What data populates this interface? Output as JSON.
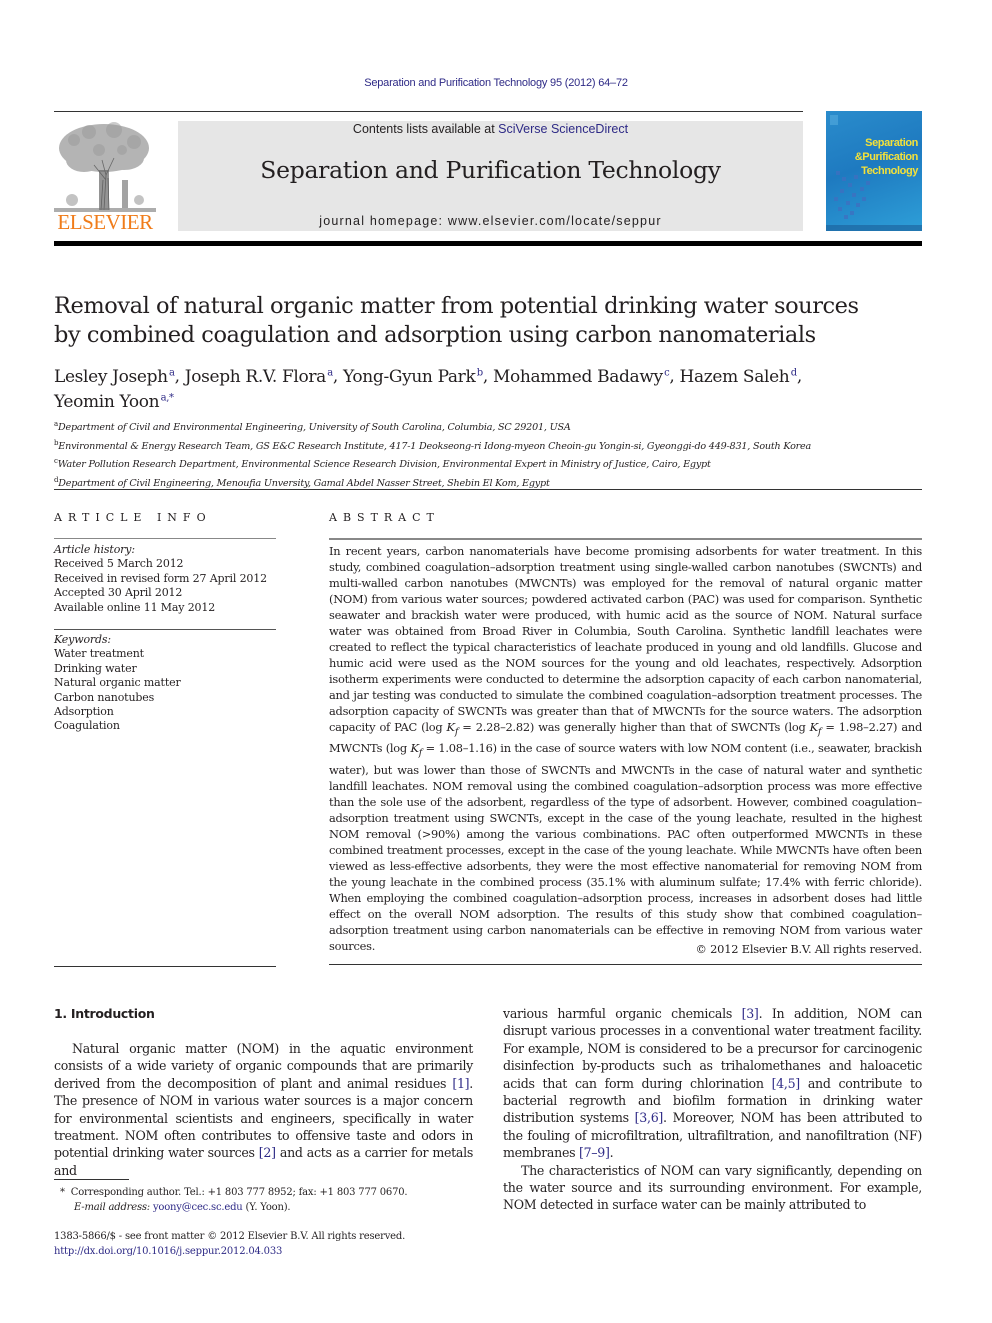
{
  "header": {
    "journal_reference": "Separation and Purification Technology 95 (2012) 64–72",
    "publisher_name": "ELSEVIER",
    "contents_prefix": "Contents lists available at ",
    "contents_link": "SciVerse ScienceDirect",
    "journal_title": "Separation and Purification Technology",
    "homepage_line": "journal homepage: www.elsevier.com/locate/seppur",
    "cover_title_lines": [
      "Separation",
      "&Purification",
      "Technology"
    ],
    "colors": {
      "link": "#2e2a86",
      "publisher_orange": "#f07c1a",
      "masthead_gray": "#e6e6e6",
      "cover_blue": "#1e7ac0",
      "cover_text_yellow": "#f3e13a"
    }
  },
  "article": {
    "title_line1": "Removal of natural organic matter from potential drinking water sources",
    "title_line2": "by combined coagulation and adsorption using carbon nanomaterials",
    "authors": [
      {
        "name": "Lesley Joseph",
        "aff": "a",
        "sep": ", "
      },
      {
        "name": "Joseph R.V. Flora",
        "aff": "a",
        "sep": ", "
      },
      {
        "name": "Yong-Gyun Park",
        "aff": "b",
        "sep": ", "
      },
      {
        "name": "Mohammed Badawy",
        "aff": "c",
        "sep": ", "
      },
      {
        "name": "Hazem Saleh",
        "aff": "d",
        "sep": ","
      },
      {
        "name": "Yeomin Yoon",
        "aff": "a,*",
        "sep": ""
      }
    ],
    "affiliations": [
      {
        "key": "a",
        "text": "Department of Civil and Environmental Engineering, University of South Carolina, Columbia, SC 29201, USA"
      },
      {
        "key": "b",
        "text": "Environmental & Energy Research Team, GS E&C Research Institute, 417-1 Deokseong-ri Idong-myeon Cheoin-gu Yongin-si, Gyeonggi-do 449-831, South Korea"
      },
      {
        "key": "c",
        "text": "Water Pollution Research Department, Environmental Science Research Division, Environmental Expert in Ministry of Justice, Cairo, Egypt"
      },
      {
        "key": "d",
        "text": "Department of Civil Engineering, Menoufia Unversity, Gamal Abdel Nasser Street, Shebin El Kom, Egypt"
      }
    ]
  },
  "article_info": {
    "heading": "ARTICLE INFO",
    "history_label": "Article history:",
    "history": [
      "Received 5 March 2012",
      "Received in revised form 27 April 2012",
      "Accepted 30 April 2012",
      "Available online 11 May 2012"
    ],
    "keywords_label": "Keywords:",
    "keywords": [
      "Water treatment",
      "Drinking water",
      "Natural organic matter",
      "Carbon nanotubes",
      "Adsorption",
      "Coagulation"
    ]
  },
  "abstract": {
    "heading": "ABSTRACT",
    "text_part1": "In recent years, carbon nanomaterials have become promising adsorbents for water treatment. In this study, combined coagulation–adsorption treatment using single-walled carbon nanotubes (SWCNTs) and multi-walled carbon nanotubes (MWCNTs) was employed for the removal of natural organic matter (NOM) from various water sources; powdered activated carbon (PAC) was used for comparison. Synthetic seawater and brackish water were produced, with humic acid as the source of NOM. Natural surface water was obtained from Broad River in Columbia, South Carolina. Synthetic landfill leachates were created to reflect the typical characteristics of leachate produced in young and old landfills. Glucose and humic acid were used as the NOM sources for the young and old leachates, respectively. Adsorption isotherm experiments were conducted to determine the adsorption capacity of each carbon nanomaterial, and jar testing was conducted to simulate the combined coagulation–adsorption treatment processes. The adsorption capacity of SWCNTs was greater than that of MWCNTs for the source waters. The adsorption capacity of PAC (log ",
    "kf_symbol": "K",
    "kf_sub": "f",
    "pac_range": " = 2.28–2.82) was generally higher than that of SWCNTs (log ",
    "swcnt_range": " = 1.98–2.27) and MWCNTs (log ",
    "text_part2": " = 1.08–1.16) in the case of source waters with low NOM content (i.e., seawater, brackish water), but was lower than those of SWCNTs and MWCNTs in the case of natural water and synthetic landfill leachates. NOM removal using the combined coagulation–adsorption process was more effective than the sole use of the adsorbent, regardless of the type of adsorbent. However, combined coagulation–adsorption treatment using SWCNTs, except in the case of the young leachate, resulted in the highest NOM removal (>90%) among the various combinations. PAC often outperformed MWCNTs in these combined treatment processes, except in the case of the young leachate. While MWCNTs have often been viewed as less-effective adsorbents, they were the most effective nanomaterial for removing NOM from the young leachate in the combined process (35.1% with aluminum sulfate; 17.4% with ferric chloride). When employing the combined coagulation–adsorption process, increases in adsorbent doses had little effect on the overall NOM adsorption. The results of this study show that combined coagulation–adsorption treatment using carbon nanomaterials can be effective in removing NOM from various water sources.",
    "copyright": "© 2012 Elsevier B.V. All rights reserved."
  },
  "body": {
    "section_heading": "1. Introduction",
    "left_p1_a": "Natural organic matter (NOM) in the aquatic environment consists of a wide variety of organic compounds that are primarily derived from the decomposition of plant and animal residues ",
    "ref1": "[1]",
    "left_p1_b": ". The presence of NOM in various water sources is a major concern for environmental scientists and engineers, specifically in water treatment. NOM often contributes to offensive taste and odors in potential drinking water sources ",
    "ref2": "[2]",
    "left_p1_c": " and acts as a carrier for metals and",
    "right_p1_a": "various harmful organic chemicals ",
    "ref3": "[3]",
    "right_p1_b": ". In addition, NOM can disrupt various processes in a conventional water treatment facility. For example, NOM is considered to be a precursor for carcinogenic disinfection by-products such as trihalomethanes and haloacetic acids that can form during chlorination ",
    "ref45": "[4,5]",
    "right_p1_c": " and contribute to bacterial regrowth and biofilm formation in drinking water distribution systems ",
    "ref36": "[3,6]",
    "right_p1_d": ". Moreover, NOM has been attributed to the fouling of microfiltration, ultrafiltration, and nanofiltration (NF) membranes ",
    "ref79": "[7–9]",
    "right_p1_e": ".",
    "right_p2": "The characteristics of NOM can vary significantly, depending on the water source and its surrounding environment. For example, NOM detected in surface water can be mainly attributed to"
  },
  "footnotes": {
    "corresponding_marker": "*",
    "corresponding": "Corresponding author. Tel.: +1 803 777 8952; fax: +1 803 777 0670.",
    "email_label": "E-mail address:",
    "email": "yoony@cec.sc.edu",
    "email_suffix": " (Y. Yoon).",
    "front_matter": "1383-5866/$ - see front matter © 2012 Elsevier B.V. All rights reserved.",
    "doi": "http://dx.doi.org/10.1016/j.seppur.2012.04.033"
  }
}
